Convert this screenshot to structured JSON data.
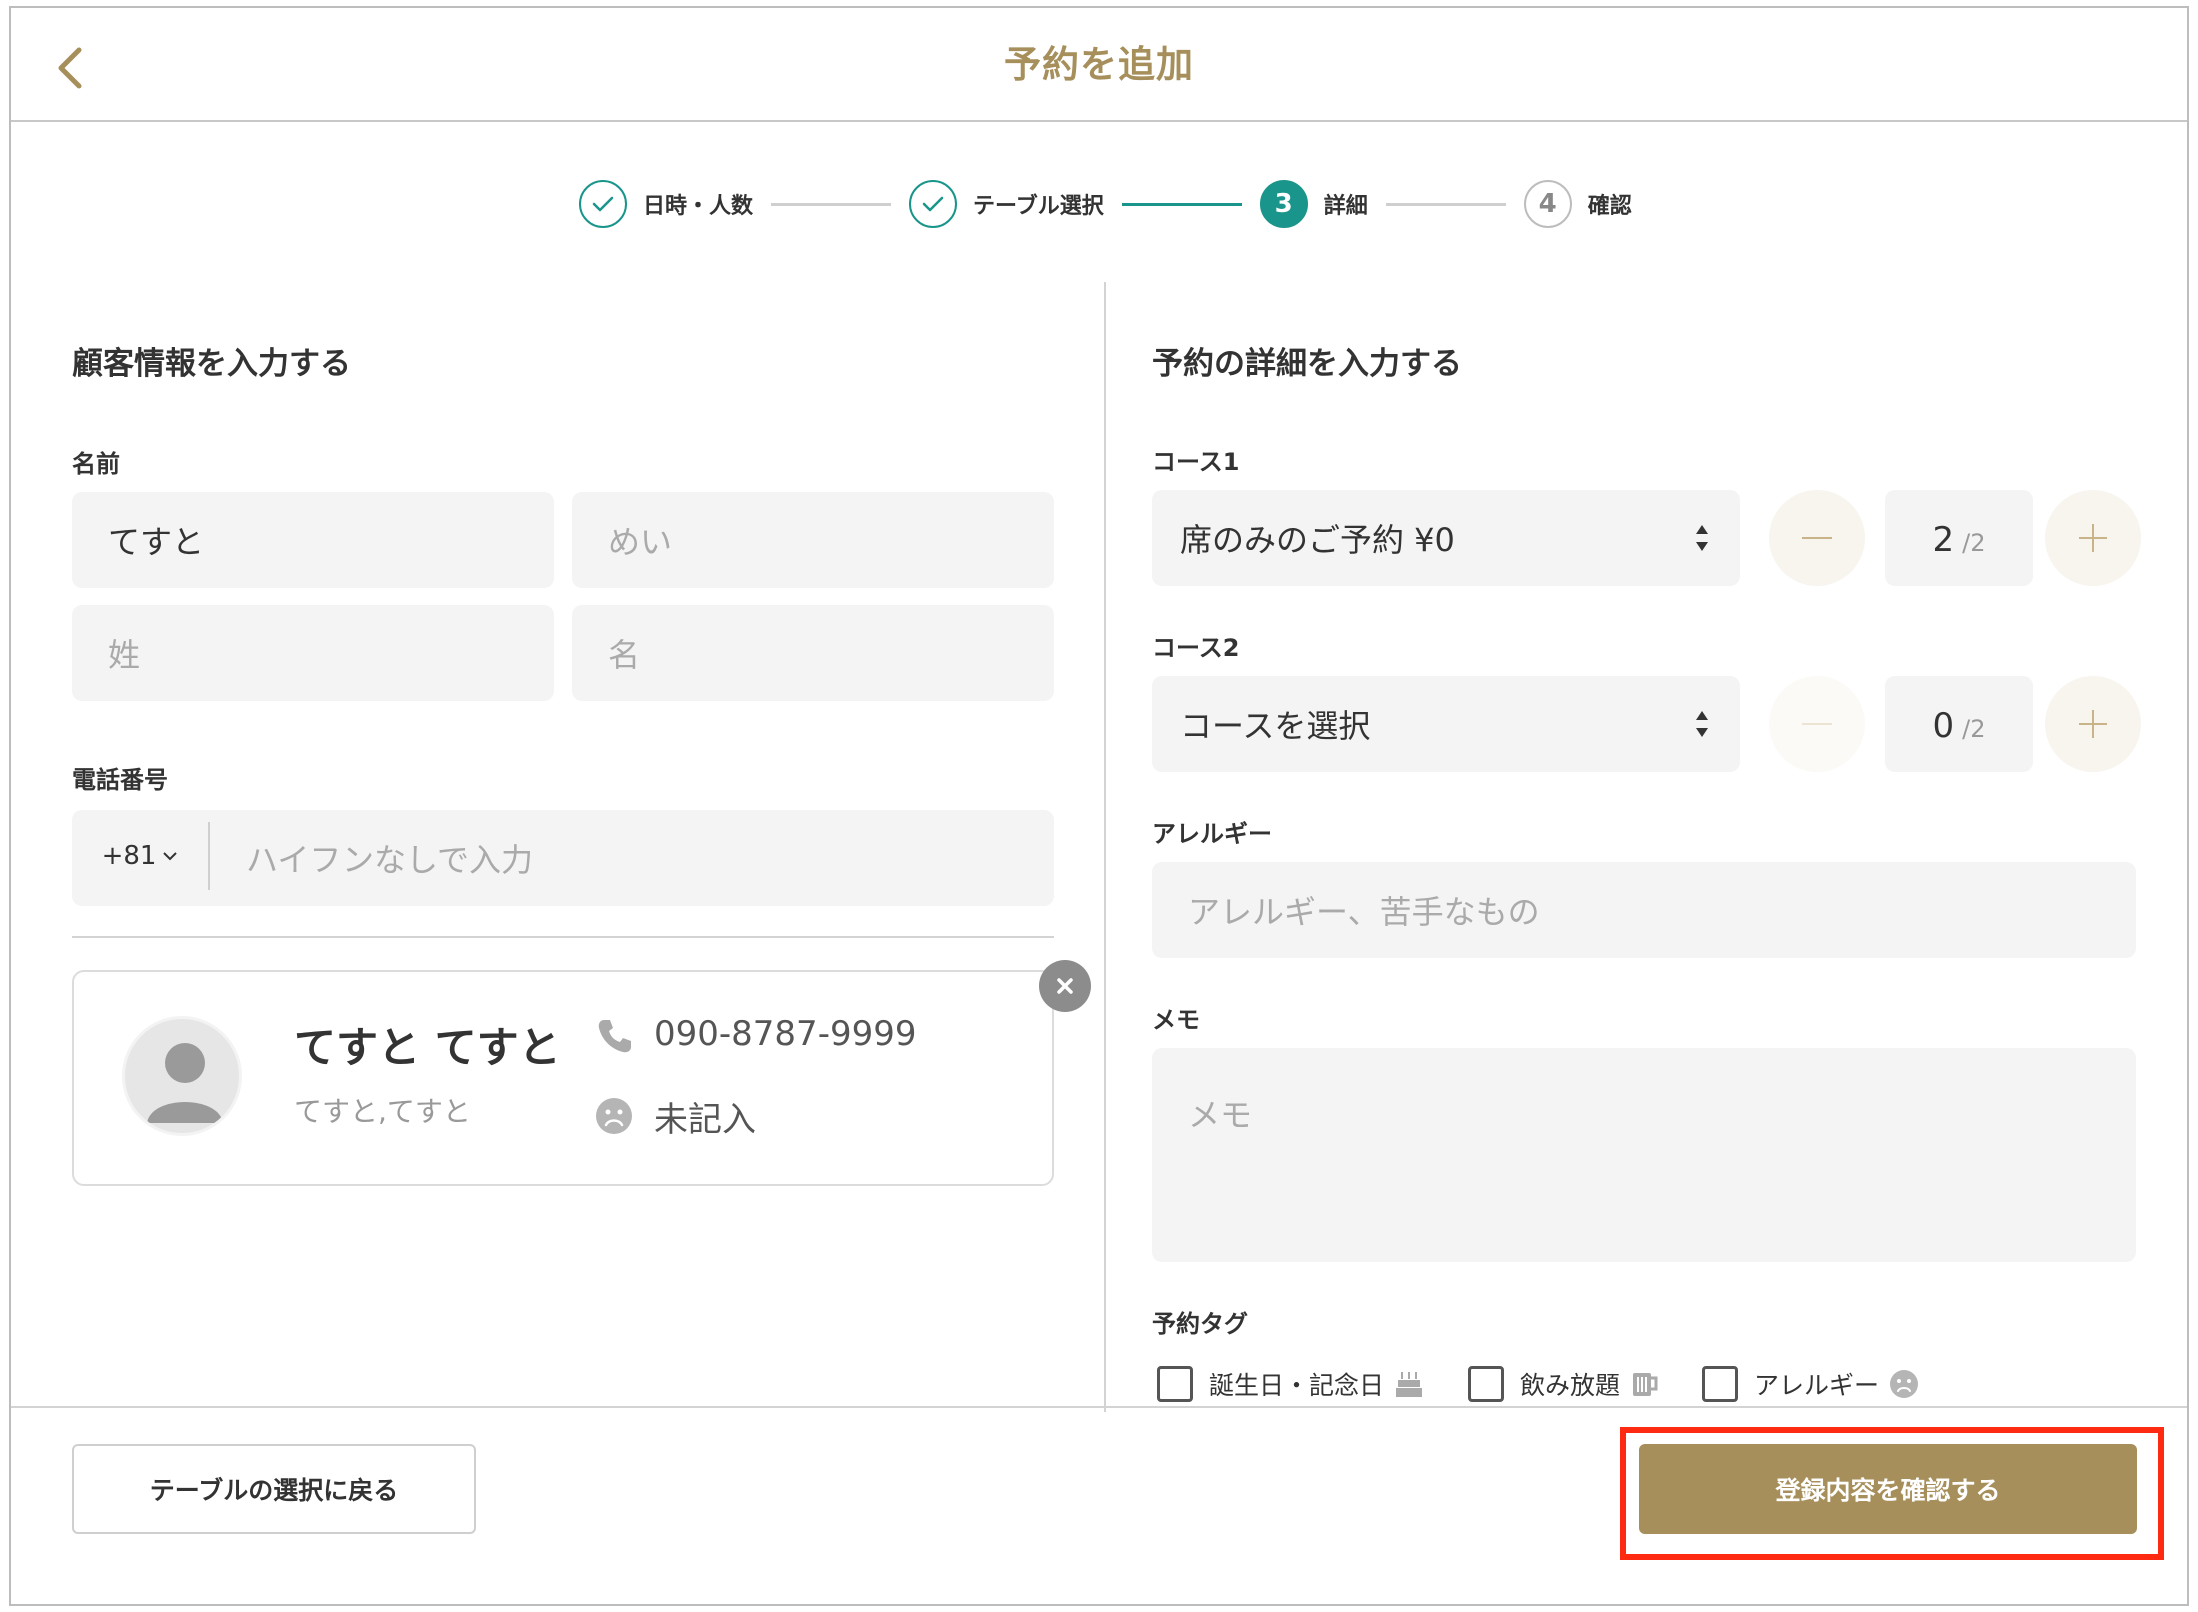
{
  "header": {
    "title": "予約を追加"
  },
  "stepper": {
    "steps": [
      {
        "number": "",
        "label": "日時・人数",
        "state": "done"
      },
      {
        "number": "",
        "label": "テーブル選択",
        "state": "done"
      },
      {
        "number": "3",
        "label": "詳細",
        "state": "active"
      },
      {
        "number": "4",
        "label": "確認",
        "state": "pending"
      }
    ]
  },
  "customer": {
    "section_title": "顧客情報を入力する",
    "name_label": "名前",
    "name_kana_last_value": "てすと",
    "name_kana_first_placeholder": "めい",
    "last_name_placeholder": "姓",
    "first_name_placeholder": "名",
    "phone_label": "電話番号",
    "phone_country_code": "+81",
    "phone_placeholder": "ハイフンなしで入力",
    "card": {
      "name": "てすと てすと",
      "kana": "てすと,てすと",
      "phone": "090-8787-9999",
      "status": "未記入"
    }
  },
  "reservation": {
    "section_title": "予約の詳細を入力する",
    "course1": {
      "label": "コース1",
      "selected": "席のみのご予約 ¥0",
      "quantity": "2",
      "max": "/2"
    },
    "course2": {
      "label": "コース2",
      "selected": "コースを選択",
      "quantity": "0",
      "max": "/2"
    },
    "allergy_label": "アレルギー",
    "allergy_placeholder": "アレルギー、苦手なもの",
    "memo_label": "メモ",
    "memo_placeholder": "メモ",
    "tags_label": "予約タグ",
    "tags": [
      {
        "label": "誕生日・記念日",
        "icon": "cake-icon",
        "checked": false
      },
      {
        "label": "飲み放題",
        "icon": "beer-mug-icon",
        "checked": false
      },
      {
        "label": "アレルギー",
        "icon": "sad-face-icon",
        "checked": false
      }
    ]
  },
  "footer": {
    "back_label": "テーブルの選択に戻る",
    "confirm_label": "登録内容を確認する"
  },
  "colors": {
    "brand_gold": "#a68f5b",
    "step_teal": "#1a958b",
    "highlight_red": "#ff2a12"
  }
}
